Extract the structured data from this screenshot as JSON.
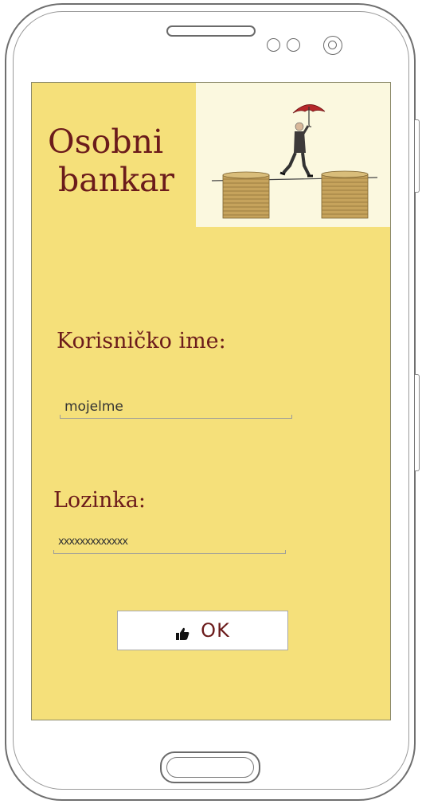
{
  "app": {
    "title": "Osobni\n bankar"
  },
  "banner": {
    "image": "businessman-umbrella-tightrope-coins"
  },
  "login": {
    "username_label": "Korisničko ime:",
    "username_value": "mojelme",
    "password_label": "Lozinka:",
    "password_value": "xxxxxxxxxxxxx",
    "ok_label": "OK",
    "ok_icon": "thumbs-up-icon"
  },
  "colors": {
    "screen_background": "#f5e07a",
    "title_text": "#6b1b1b",
    "banner_background": "#fbf8df"
  }
}
